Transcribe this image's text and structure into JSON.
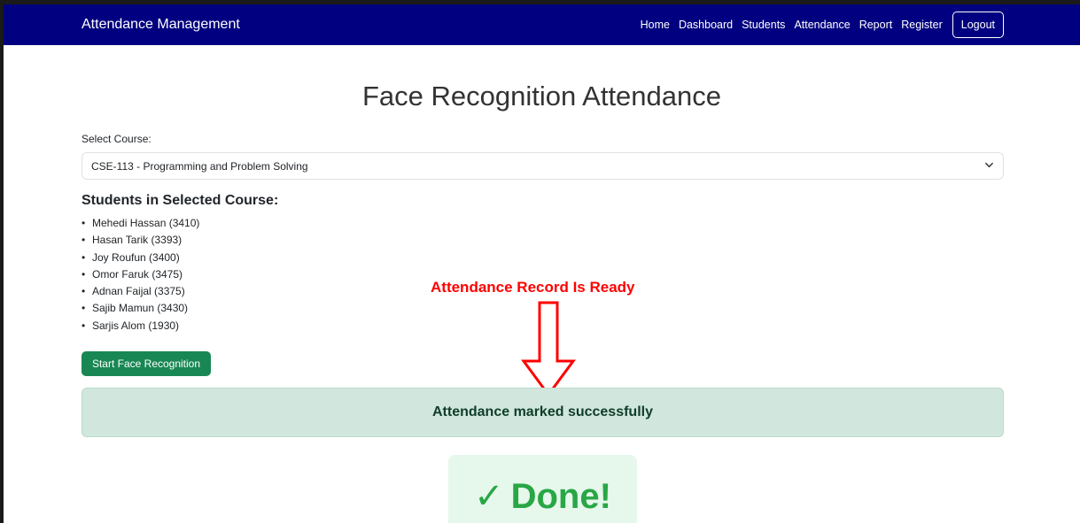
{
  "navbar": {
    "brand": "Attendance Management",
    "links": [
      "Home",
      "Dashboard",
      "Students",
      "Attendance",
      "Report",
      "Register"
    ],
    "logout_label": "Logout",
    "background_color": "#000080"
  },
  "main": {
    "title": "Face Recognition Attendance",
    "select_label": "Select Course:",
    "selected_course": "CSE-113 - Programming and Problem Solving",
    "students_heading": "Students in Selected Course:",
    "students": [
      "Mehedi Hassan (3410)",
      "Hasan Tarik (3393)",
      "Joy Roufun (3400)",
      "Omor Faruk (3475)",
      "Adnan Faijal (3375)",
      "Sajib Mamun (3430)",
      "Sarjis Alom (1930)"
    ],
    "start_button": "Start Face Recognition",
    "alert_text": "Attendance marked successfully",
    "done_check": "✓",
    "done_text": "Done!"
  },
  "annotation": {
    "text": "Attendance Record Is Ready",
    "color": "#ff0000"
  },
  "colors": {
    "success_button": "#198754",
    "alert_background": "#d1e7dd",
    "done_green": "#28a745"
  }
}
